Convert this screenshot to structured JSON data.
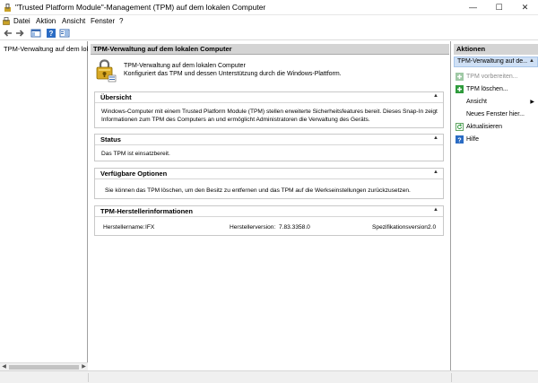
{
  "window": {
    "title": "\"Trusted Platform Module\"-Management (TPM) auf dem lokalen Computer",
    "minimize": "—",
    "maximize": "☐",
    "close": "✕"
  },
  "menu": {
    "items": [
      "Datei",
      "Aktion",
      "Ansicht",
      "Fenster",
      "?"
    ]
  },
  "toolbar": {
    "buttons": [
      "back-icon",
      "forward-icon",
      "console-tree-icon",
      "help-icon",
      "properties-icon"
    ]
  },
  "tree": {
    "root_label": "TPM-Verwaltung auf dem lok"
  },
  "center": {
    "header": "TPM-Verwaltung auf dem lokalen Computer",
    "intro_line1": "TPM-Verwaltung auf dem lokalen Computer",
    "intro_line2": "Konfiguriert das TPM und dessen Unterstützung durch die Windows-Plattform.",
    "overview": {
      "title": "Übersicht",
      "line1": "Windows-Computer mit einem Trusted Platform Module (TPM) stellen erweiterte Sicherheitsfeatures bereit. Dieses Snap-In zeigt",
      "line2": "Informationen zum TPM des Computers an und ermöglicht Administratoren die Verwaltung des Geräts."
    },
    "status": {
      "title": "Status",
      "text": "Das TPM ist einsatzbereit."
    },
    "options": {
      "title": "Verfügbare Optionen",
      "text": "Sie können das TPM löschen, um den Besitz zu entfernen und das TPM auf die Werkseinstellungen zurückzusetzen."
    },
    "manufacturer": {
      "title": "TPM-Herstellerinformationen",
      "name_label": "Herstellername:",
      "name_value": "IFX",
      "version_label": "Herstellerversion:",
      "version_value": "7.83.3358.0",
      "spec_label": "Spezifikationsversion:",
      "spec_value": "2.0"
    },
    "collapse_glyph": "▲"
  },
  "actions": {
    "header": "Aktionen",
    "group": "TPM-Verwaltung auf de...",
    "group_arrow": "▲",
    "items": [
      {
        "label": "TPM vorbereiten...",
        "icon": "tpm-green-icon",
        "enabled": false
      },
      {
        "label": "TPM löschen...",
        "icon": "tpm-green-icon",
        "enabled": true
      },
      {
        "label": "Ansicht",
        "icon": "",
        "enabled": true
      },
      {
        "label": "Neues Fenster hier...",
        "icon": "",
        "enabled": true
      },
      {
        "label": "Aktualisieren",
        "icon": "refresh-icon",
        "enabled": true
      },
      {
        "label": "Hilfe",
        "icon": "help-icon",
        "enabled": true
      }
    ],
    "submenu_arrow": "▶"
  },
  "colors": {
    "header_bg": "#d4d4d4",
    "group_bg": "#cfe0f5",
    "disabled_text": "#8c8c8c",
    "green_icon": "#2e9b3b",
    "help_blue": "#2b6cc4"
  }
}
